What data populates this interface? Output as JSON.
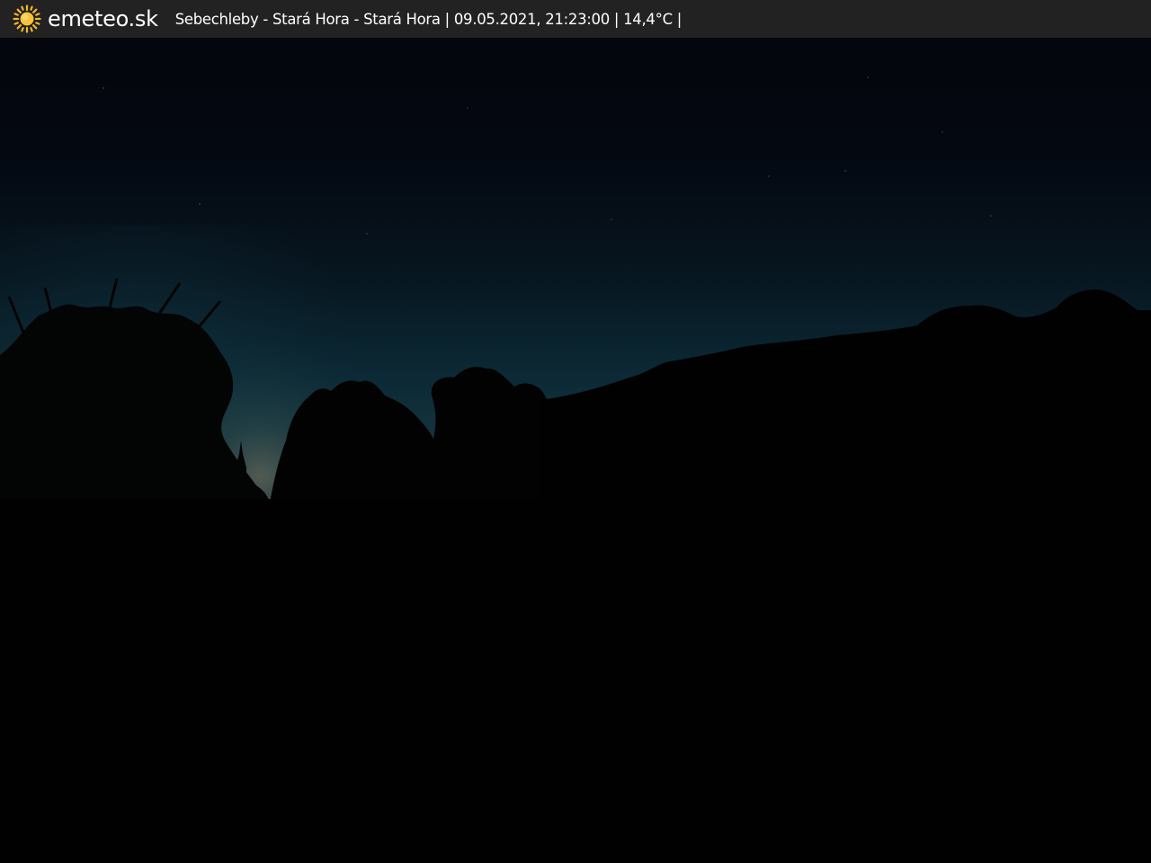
{
  "header": {
    "brand": "emeteo.sk",
    "logo_icon": "sun-icon",
    "caption": "Sebechleby - Stará Hora - Stará Hora | 09.05.2021, 21:23:00 | 14,4°C |"
  },
  "colors": {
    "bar_background": "#222222",
    "sun": "#f5b82e",
    "sky_top": "#03060d",
    "sky_horizon": "#0d2f3b",
    "glow": "#4a5a5c",
    "ground": "#010101"
  }
}
